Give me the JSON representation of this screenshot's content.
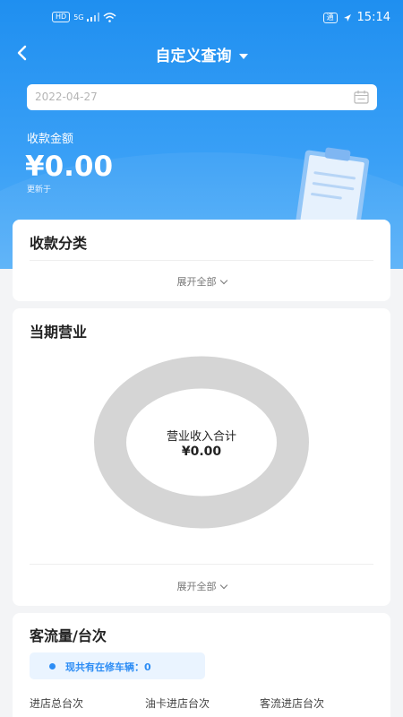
{
  "status_bar": {
    "network_left": "HD",
    "signal_label": "5G",
    "chip": "通",
    "time": "15:14"
  },
  "header": {
    "title": "自定义查询",
    "back_icon": "chevron-left-icon",
    "dropdown_icon": "caret-down-icon"
  },
  "date_field": {
    "value": "2022-04-27",
    "icon": "calendar-icon"
  },
  "summary": {
    "amount_label": "收款金额",
    "amount_value": "¥0.00",
    "updated_label": "更新于"
  },
  "colors": {
    "primary": "#1f8ff0",
    "accent": "#2d8df5",
    "donut": "#d5d5d5"
  },
  "payment_category": {
    "title": "收款分类",
    "expand_label": "展开全部"
  },
  "business": {
    "title": "当期营业",
    "donut_label": "营业收入合计",
    "donut_value": "¥0.00",
    "expand_label": "展开全部"
  },
  "traffic": {
    "title": "客流量/台次",
    "repair_text": "现共有在修车辆：0",
    "stats": [
      {
        "label": "进店总台次"
      },
      {
        "label": "油卡进店台次"
      },
      {
        "label": "客流进店台次"
      }
    ]
  }
}
